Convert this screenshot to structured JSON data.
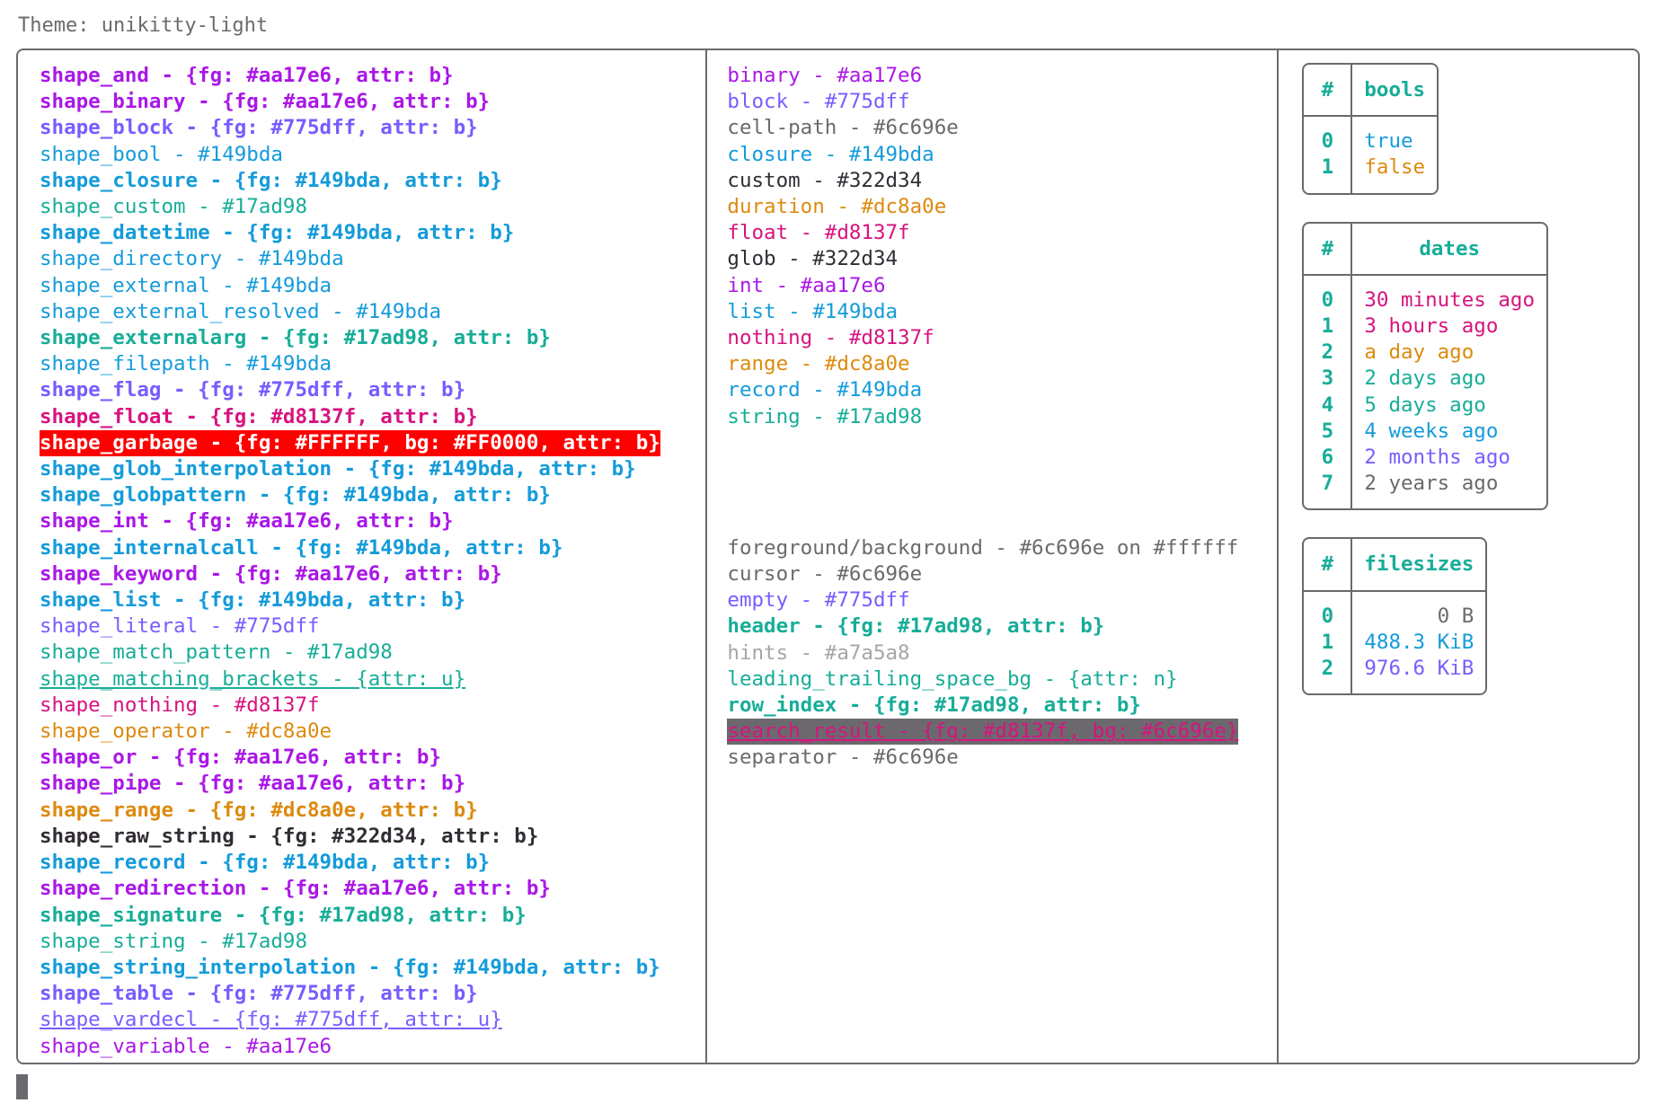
{
  "theme_line": "Theme: unikitty-light",
  "colors": {
    "purple": "#aa17e6",
    "violet": "#775dff",
    "blue": "#149bda",
    "teal": "#17ad98",
    "pink": "#d8137f",
    "orange": "#dc8a0e",
    "dark": "#322d34",
    "gray": "#6c696e",
    "hint": "#a7a5a8",
    "garbage_fg": "#FFFFFF",
    "garbage_bg": "#FF0000",
    "search_fg": "#d8137f",
    "search_bg": "#6c696e",
    "background": "#ffffff"
  },
  "shapes": [
    {
      "text": "shape_and - {fg: #aa17e6, attr: b}",
      "cls": "c-purple b"
    },
    {
      "text": "shape_binary - {fg: #aa17e6, attr: b}",
      "cls": "c-purple b"
    },
    {
      "text": "shape_block - {fg: #775dff, attr: b}",
      "cls": "c-violet b"
    },
    {
      "text": "shape_bool - #149bda",
      "cls": "c-blue"
    },
    {
      "text": "shape_closure - {fg: #149bda, attr: b}",
      "cls": "c-blue b"
    },
    {
      "text": "shape_custom - #17ad98",
      "cls": "c-teal"
    },
    {
      "text": "shape_datetime - {fg: #149bda, attr: b}",
      "cls": "c-blue b"
    },
    {
      "text": "shape_directory - #149bda",
      "cls": "c-blue"
    },
    {
      "text": "shape_external - #149bda",
      "cls": "c-blue"
    },
    {
      "text": "shape_external_resolved - #149bda",
      "cls": "c-blue"
    },
    {
      "text": "shape_externalarg - {fg: #17ad98, attr: b}",
      "cls": "c-teal b"
    },
    {
      "text": "shape_filepath - #149bda",
      "cls": "c-blue"
    },
    {
      "text": "shape_flag - {fg: #775dff, attr: b}",
      "cls": "c-violet b"
    },
    {
      "text": "shape_float - {fg: #d8137f, attr: b}",
      "cls": "c-pink b"
    },
    {
      "text": "shape_garbage - {fg: #FFFFFF, bg: #FF0000, attr: b}",
      "cls": "hl-red"
    },
    {
      "text": "shape_glob_interpolation - {fg: #149bda, attr: b}",
      "cls": "c-blue b"
    },
    {
      "text": "shape_globpattern - {fg: #149bda, attr: b}",
      "cls": "c-blue b"
    },
    {
      "text": "shape_int - {fg: #aa17e6, attr: b}",
      "cls": "c-purple b"
    },
    {
      "text": "shape_internalcall - {fg: #149bda, attr: b}",
      "cls": "c-blue b"
    },
    {
      "text": "shape_keyword - {fg: #aa17e6, attr: b}",
      "cls": "c-purple b"
    },
    {
      "text": "shape_list - {fg: #149bda, attr: b}",
      "cls": "c-blue b"
    },
    {
      "text": "shape_literal - #775dff",
      "cls": "c-violet"
    },
    {
      "text": "shape_match_pattern - #17ad98",
      "cls": "c-teal"
    },
    {
      "text": "shape_matching_brackets - {attr: u}",
      "cls": "c-teal u"
    },
    {
      "text": "shape_nothing - #d8137f",
      "cls": "c-pink"
    },
    {
      "text": "shape_operator - #dc8a0e",
      "cls": "c-orange"
    },
    {
      "text": "shape_or - {fg: #aa17e6, attr: b}",
      "cls": "c-purple b"
    },
    {
      "text": "shape_pipe - {fg: #aa17e6, attr: b}",
      "cls": "c-purple b"
    },
    {
      "text": "shape_range - {fg: #dc8a0e, attr: b}",
      "cls": "c-orange b"
    },
    {
      "text": "shape_raw_string - {fg: #322d34, attr: b}",
      "cls": "c-dark b"
    },
    {
      "text": "shape_record - {fg: #149bda, attr: b}",
      "cls": "c-blue b"
    },
    {
      "text": "shape_redirection - {fg: #aa17e6, attr: b}",
      "cls": "c-purple b"
    },
    {
      "text": "shape_signature - {fg: #17ad98, attr: b}",
      "cls": "c-teal b"
    },
    {
      "text": "shape_string - #17ad98",
      "cls": "c-teal"
    },
    {
      "text": "shape_string_interpolation - {fg: #149bda, attr: b}",
      "cls": "c-blue b"
    },
    {
      "text": "shape_table - {fg: #775dff, attr: b}",
      "cls": "c-violet b"
    },
    {
      "text": "shape_vardecl - {fg: #775dff, attr: u}",
      "cls": "c-violet u"
    },
    {
      "text": "shape_variable - #aa17e6",
      "cls": "c-purple"
    }
  ],
  "types": [
    {
      "text": "binary - #aa17e6",
      "cls": "c-purple"
    },
    {
      "text": "block - #775dff",
      "cls": "c-violet"
    },
    {
      "text": "cell-path - #6c696e",
      "cls": "c-gray"
    },
    {
      "text": "closure - #149bda",
      "cls": "c-blue"
    },
    {
      "text": "custom - #322d34",
      "cls": "c-dark"
    },
    {
      "text": "duration - #dc8a0e",
      "cls": "c-orange"
    },
    {
      "text": "float - #d8137f",
      "cls": "c-pink"
    },
    {
      "text": "glob - #322d34",
      "cls": "c-dark"
    },
    {
      "text": "int - #aa17e6",
      "cls": "c-purple"
    },
    {
      "text": "list - #149bda",
      "cls": "c-blue"
    },
    {
      "text": "nothing - #d8137f",
      "cls": "c-pink"
    },
    {
      "text": "range - #dc8a0e",
      "cls": "c-orange"
    },
    {
      "text": "record - #149bda",
      "cls": "c-blue"
    },
    {
      "text": "string - #17ad98",
      "cls": "c-teal"
    }
  ],
  "ui_elements": [
    {
      "text": "foreground/background - #6c696e on #ffffff",
      "cls": "c-gray"
    },
    {
      "text": "cursor - #6c696e",
      "cls": "c-gray"
    },
    {
      "text": "empty - #775dff",
      "cls": "c-violet"
    },
    {
      "text": "header - {fg: #17ad98, attr: b}",
      "cls": "c-teal b"
    },
    {
      "text": "hints - #a7a5a8",
      "cls": "c-hint"
    },
    {
      "text": "leading_trailing_space_bg - {attr: n}",
      "cls": "c-teal"
    },
    {
      "text": "row_index - {fg: #17ad98, attr: b}",
      "cls": "c-teal b"
    },
    {
      "text": "search_result - {fg: #d8137f, bg: #6c696e}",
      "cls": "hl-gray"
    },
    {
      "text": "separator - #6c696e",
      "cls": "c-gray"
    }
  ],
  "tables": [
    {
      "name": "bools",
      "index_header": "#",
      "value_header": "bools",
      "align": "left",
      "rows": [
        {
          "index": "0",
          "value": "true",
          "cls": "c-blue"
        },
        {
          "index": "1",
          "value": "false",
          "cls": "c-orange"
        }
      ]
    },
    {
      "name": "dates",
      "index_header": "#",
      "value_header": "dates",
      "align": "left",
      "rows": [
        {
          "index": "0",
          "value": "30 minutes ago",
          "cls": "c-pink b"
        },
        {
          "index": "1",
          "value": "3 hours ago",
          "cls": "c-pink"
        },
        {
          "index": "2",
          "value": "a day ago",
          "cls": "c-orange"
        },
        {
          "index": "3",
          "value": "2 days ago",
          "cls": "c-teal"
        },
        {
          "index": "4",
          "value": "5 days ago",
          "cls": "c-teal b"
        },
        {
          "index": "5",
          "value": "4 weeks ago",
          "cls": "c-blue"
        },
        {
          "index": "6",
          "value": "2 months ago",
          "cls": "c-violet"
        },
        {
          "index": "7",
          "value": "2 years ago",
          "cls": "c-gray"
        }
      ]
    },
    {
      "name": "filesizes",
      "index_header": "#",
      "value_header": "filesizes",
      "align": "right",
      "rows": [
        {
          "index": "0",
          "value": "0 B",
          "cls": "c-gray"
        },
        {
          "index": "1",
          "value": "488.3 KiB",
          "cls": "c-blue"
        },
        {
          "index": "2",
          "value": "976.6 KiB",
          "cls": "c-violet"
        }
      ]
    }
  ]
}
